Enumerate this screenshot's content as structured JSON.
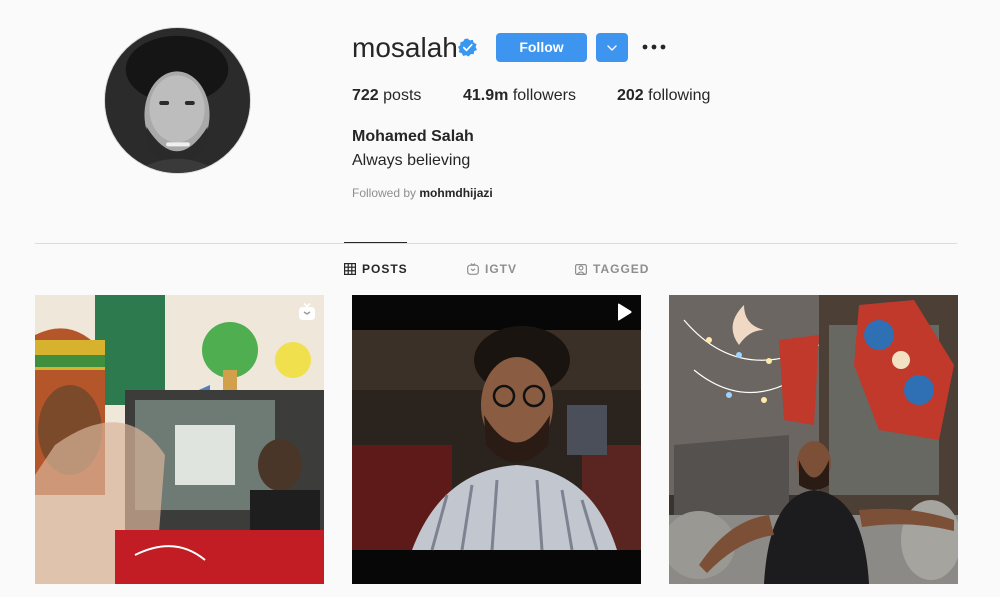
{
  "profile": {
    "username": "mosalah",
    "verified": true,
    "full_name": "Mohamed Salah",
    "bio": "Always believing",
    "followed_by_prefix": "Followed by",
    "followed_by_user": "mohmdhijazi"
  },
  "actions": {
    "follow_label": "Follow",
    "more_icon": "ellipsis-icon",
    "dropdown_icon": "chevron-down-icon"
  },
  "stats": {
    "posts_count": "722",
    "posts_label": "posts",
    "followers_count": "41.9m",
    "followers_label": "followers",
    "following_count": "202",
    "following_label": "following"
  },
  "tabs": [
    {
      "label": "POSTS",
      "icon": "grid-icon",
      "active": true
    },
    {
      "label": "IGTV",
      "icon": "igtv-icon",
      "active": false
    },
    {
      "label": "TAGGED",
      "icon": "tagged-icon",
      "active": false
    }
  ],
  "posts": [
    {
      "type": "igtv",
      "badge_icon": "igtv-icon"
    },
    {
      "type": "video",
      "badge_icon": "play-icon"
    },
    {
      "type": "photo"
    }
  ],
  "colors": {
    "accent": "#3e95f0",
    "background": "#fafafa",
    "text": "#262626",
    "muted": "#8e8e8e",
    "divider": "#dbdbdb"
  }
}
